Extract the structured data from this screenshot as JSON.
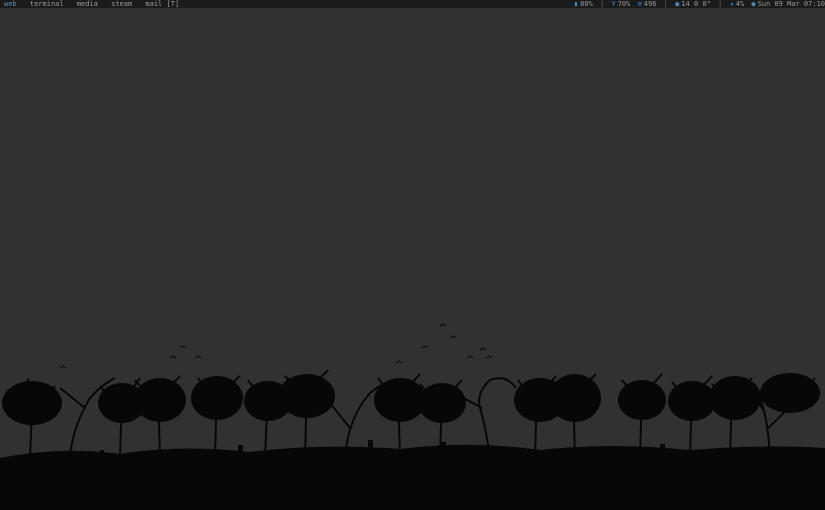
{
  "bar": {
    "workspaces": [
      {
        "label": "web",
        "active": true
      },
      {
        "label": "terminal",
        "active": false
      },
      {
        "label": "media",
        "active": false
      },
      {
        "label": "steam",
        "active": false
      },
      {
        "label": "mail [T]",
        "active": false
      }
    ],
    "status": {
      "battery": {
        "icon": "battery-icon",
        "value": "80%"
      },
      "wifi": {
        "icon": "wifi-signal-icon",
        "value": "70%"
      },
      "memory": {
        "icon": "memory-icon",
        "value": "496"
      },
      "updates": {
        "icon": "package-icon",
        "value": "14 0 0\""
      },
      "volume": {
        "icon": "speaker-icon",
        "value": "4%"
      },
      "clock": {
        "icon": "clock-icon",
        "value": "Sun 09 Mar 07:10"
      }
    }
  },
  "colors": {
    "background": "#313131",
    "bar_background": "#1b1b1b",
    "bar_text": "#9a9a9a",
    "accent": "#4f87c4",
    "silhouette": "#050505"
  }
}
